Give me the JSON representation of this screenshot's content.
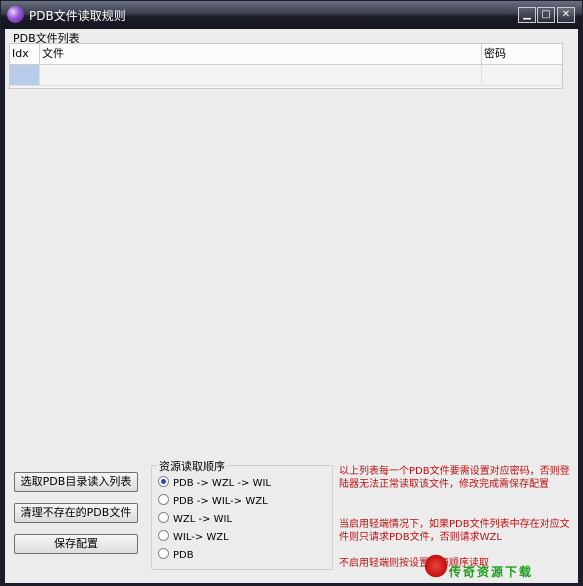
{
  "window": {
    "title": "PDB文件读取规则"
  },
  "list_group": {
    "label": "PDB文件列表",
    "columns": [
      "Idx",
      "文件",
      "密码"
    ]
  },
  "buttons": {
    "import": "选取PDB目录读入列表",
    "cleanup": "清理不存在的PDB文件",
    "save": "保存配置"
  },
  "order_group": {
    "label": "资源读取顺序",
    "options": [
      "PDB -> WZL -> WIL",
      "PDB -> WIL-> WZL",
      "WZL -> WIL",
      "WIL-> WZL",
      "PDB"
    ],
    "selected_index": 0
  },
  "info": {
    "line1": "以上列表每一个PDB文件要需设置对应密码，否则登陆器无法正常读取该文件，修改完成需保存配置",
    "line2": "当启用轻端情况下，如果PDB文件列表中存在对应文件则只请求PDB文件，否则请求WZL",
    "line3": "不启用轻端则按设置资源顺序读取"
  },
  "watermark": {
    "text": "传奇资源下载"
  },
  "colors": {
    "info_text": "#c01010",
    "selected_cell": "#b8cbe8"
  }
}
